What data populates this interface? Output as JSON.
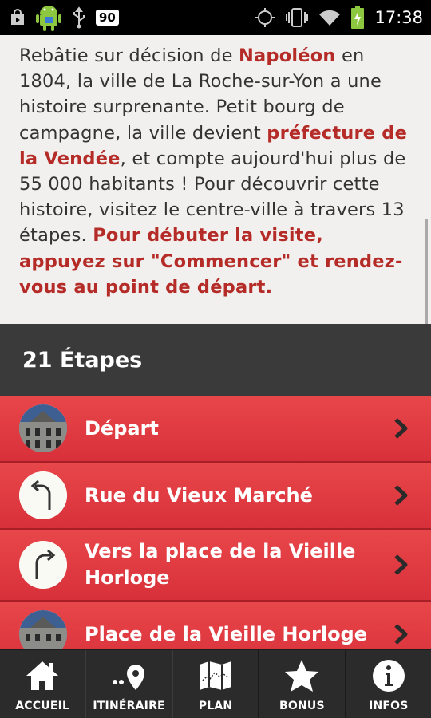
{
  "status_bar": {
    "battery_level": "90",
    "time": "17:38",
    "icons": [
      "shopping-bag-icon",
      "android-icon",
      "usb-icon",
      "battery-badge-icon",
      "gps-icon",
      "vibrate-icon",
      "wifi-icon",
      "charging-battery-icon"
    ]
  },
  "intro": {
    "t1": "Rebâtie sur décision de ",
    "h1": "Napoléon",
    "t2": " en 1804, la ville de La Roche-sur-Yon a une histoire surprenante. Petit bourg de campagne, la ville devient ",
    "h2": "préfecture de la Vendée",
    "t3": ", et compte aujourd'hui plus de 55 000 habitants ! Pour découvrir cette histoire, visitez le centre-ville à travers 13 étapes. ",
    "h3": "Pour débuter la visite, appuyez sur \"Commencer\" et rendez-vous au point de départ."
  },
  "section": {
    "title": "21 Étapes"
  },
  "steps": [
    {
      "label": "Départ",
      "icon": "building-photo"
    },
    {
      "label": "Rue du Vieux Marché",
      "icon": "turn-left-arrow-icon"
    },
    {
      "label": "Vers la place de la Vieille Horloge",
      "icon": "turn-right-arrow-icon"
    },
    {
      "label": "Place de la Vieille Horloge",
      "icon": "building-photo"
    }
  ],
  "nav": [
    {
      "label": "ACCUEIL",
      "icon": "home-icon"
    },
    {
      "label": "ITINÉRAIRE",
      "icon": "route-pin-icon"
    },
    {
      "label": "PLAN",
      "icon": "map-icon"
    },
    {
      "label": "BONUS",
      "icon": "star-icon"
    },
    {
      "label": "INFOS",
      "icon": "info-icon"
    }
  ],
  "colors": {
    "accent": "#b52b27",
    "step_bg": "#e0393f",
    "header_bg": "#3a3a3a",
    "nav_bg": "#2b2b2b"
  }
}
